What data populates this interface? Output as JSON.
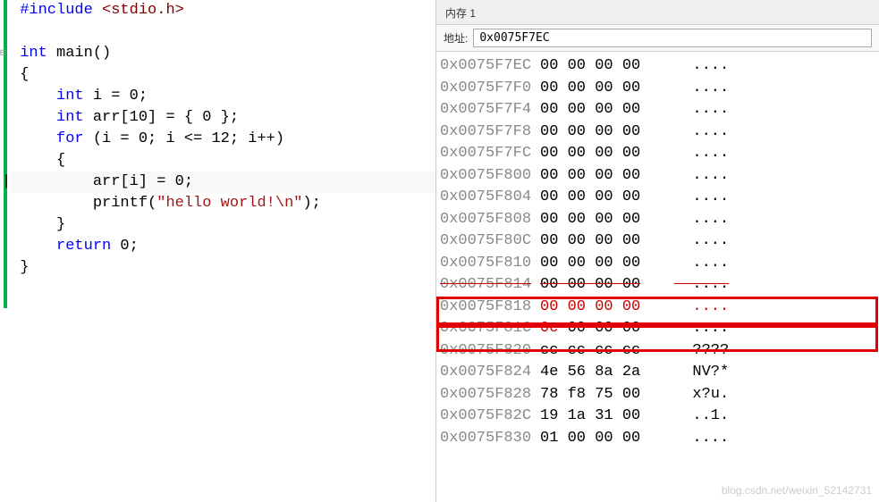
{
  "code": {
    "include_kw": "#include",
    "include_header": "<stdio.h>",
    "type_int": "int",
    "main_name": "main",
    "decl_i": "int i = 0;",
    "decl_arr": "int arr[10] = { 0 };",
    "for_kw": "for",
    "for_expr": " (i = 0; i <= 12; i++)",
    "assign": "arr[i] = 0;",
    "printf_name": "printf",
    "printf_str": "\"hello world!\\n\"",
    "return_kw": "return",
    "return_val": " 0;"
  },
  "memory": {
    "title": "内存 1",
    "addr_label": "地址:",
    "addr_value": "0x0075F7EC",
    "rows": [
      {
        "addr": "0x0075F7EC",
        "hex": "00 00 00 00",
        "txt": "....",
        "red": false,
        "struck": false
      },
      {
        "addr": "0x0075F7F0",
        "hex": "00 00 00 00",
        "txt": "....",
        "red": false,
        "struck": false
      },
      {
        "addr": "0x0075F7F4",
        "hex": "00 00 00 00",
        "txt": "....",
        "red": false,
        "struck": false
      },
      {
        "addr": "0x0075F7F8",
        "hex": "00 00 00 00",
        "txt": "....",
        "red": false,
        "struck": false
      },
      {
        "addr": "0x0075F7FC",
        "hex": "00 00 00 00",
        "txt": "....",
        "red": false,
        "struck": false
      },
      {
        "addr": "0x0075F800",
        "hex": "00 00 00 00",
        "txt": "....",
        "red": false,
        "struck": false
      },
      {
        "addr": "0x0075F804",
        "hex": "00 00 00 00",
        "txt": "....",
        "red": false,
        "struck": false
      },
      {
        "addr": "0x0075F808",
        "hex": "00 00 00 00",
        "txt": "....",
        "red": false,
        "struck": false
      },
      {
        "addr": "0x0075F80C",
        "hex": "00 00 00 00",
        "txt": "....",
        "red": false,
        "struck": false
      },
      {
        "addr": "0x0075F810",
        "hex": "00 00 00 00",
        "txt": "....",
        "red": false,
        "struck": false
      },
      {
        "addr": "0x0075F814",
        "hex": "00 00 00 00",
        "txt": "....",
        "red": false,
        "struck": true
      },
      {
        "addr": "0x0075F818",
        "hex": "00 00 00 00",
        "txt": "....",
        "red": true,
        "struck": false
      },
      {
        "addr": "0x0075F81C",
        "hex": "0c 00 00 00",
        "txt": "....",
        "red": false,
        "struck": false,
        "firstRed": true
      },
      {
        "addr": "0x0075F820",
        "hex": "cc cc cc cc",
        "txt": "????",
        "red": false,
        "struck": true
      },
      {
        "addr": "0x0075F824",
        "hex": "4e 56 8a 2a",
        "txt": "NV?*",
        "red": false,
        "struck": false
      },
      {
        "addr": "0x0075F828",
        "hex": "78 f8 75 00",
        "txt": "x?u.",
        "red": false,
        "struck": false
      },
      {
        "addr": "0x0075F82C",
        "hex": "19 1a 31 00",
        "txt": "..1.",
        "red": false,
        "struck": false
      },
      {
        "addr": "0x0075F830",
        "hex": "01 00 00 00",
        "txt": "....",
        "red": false,
        "struck": false
      }
    ]
  },
  "watermark": "blog.csdn.net/weixin_52142731"
}
